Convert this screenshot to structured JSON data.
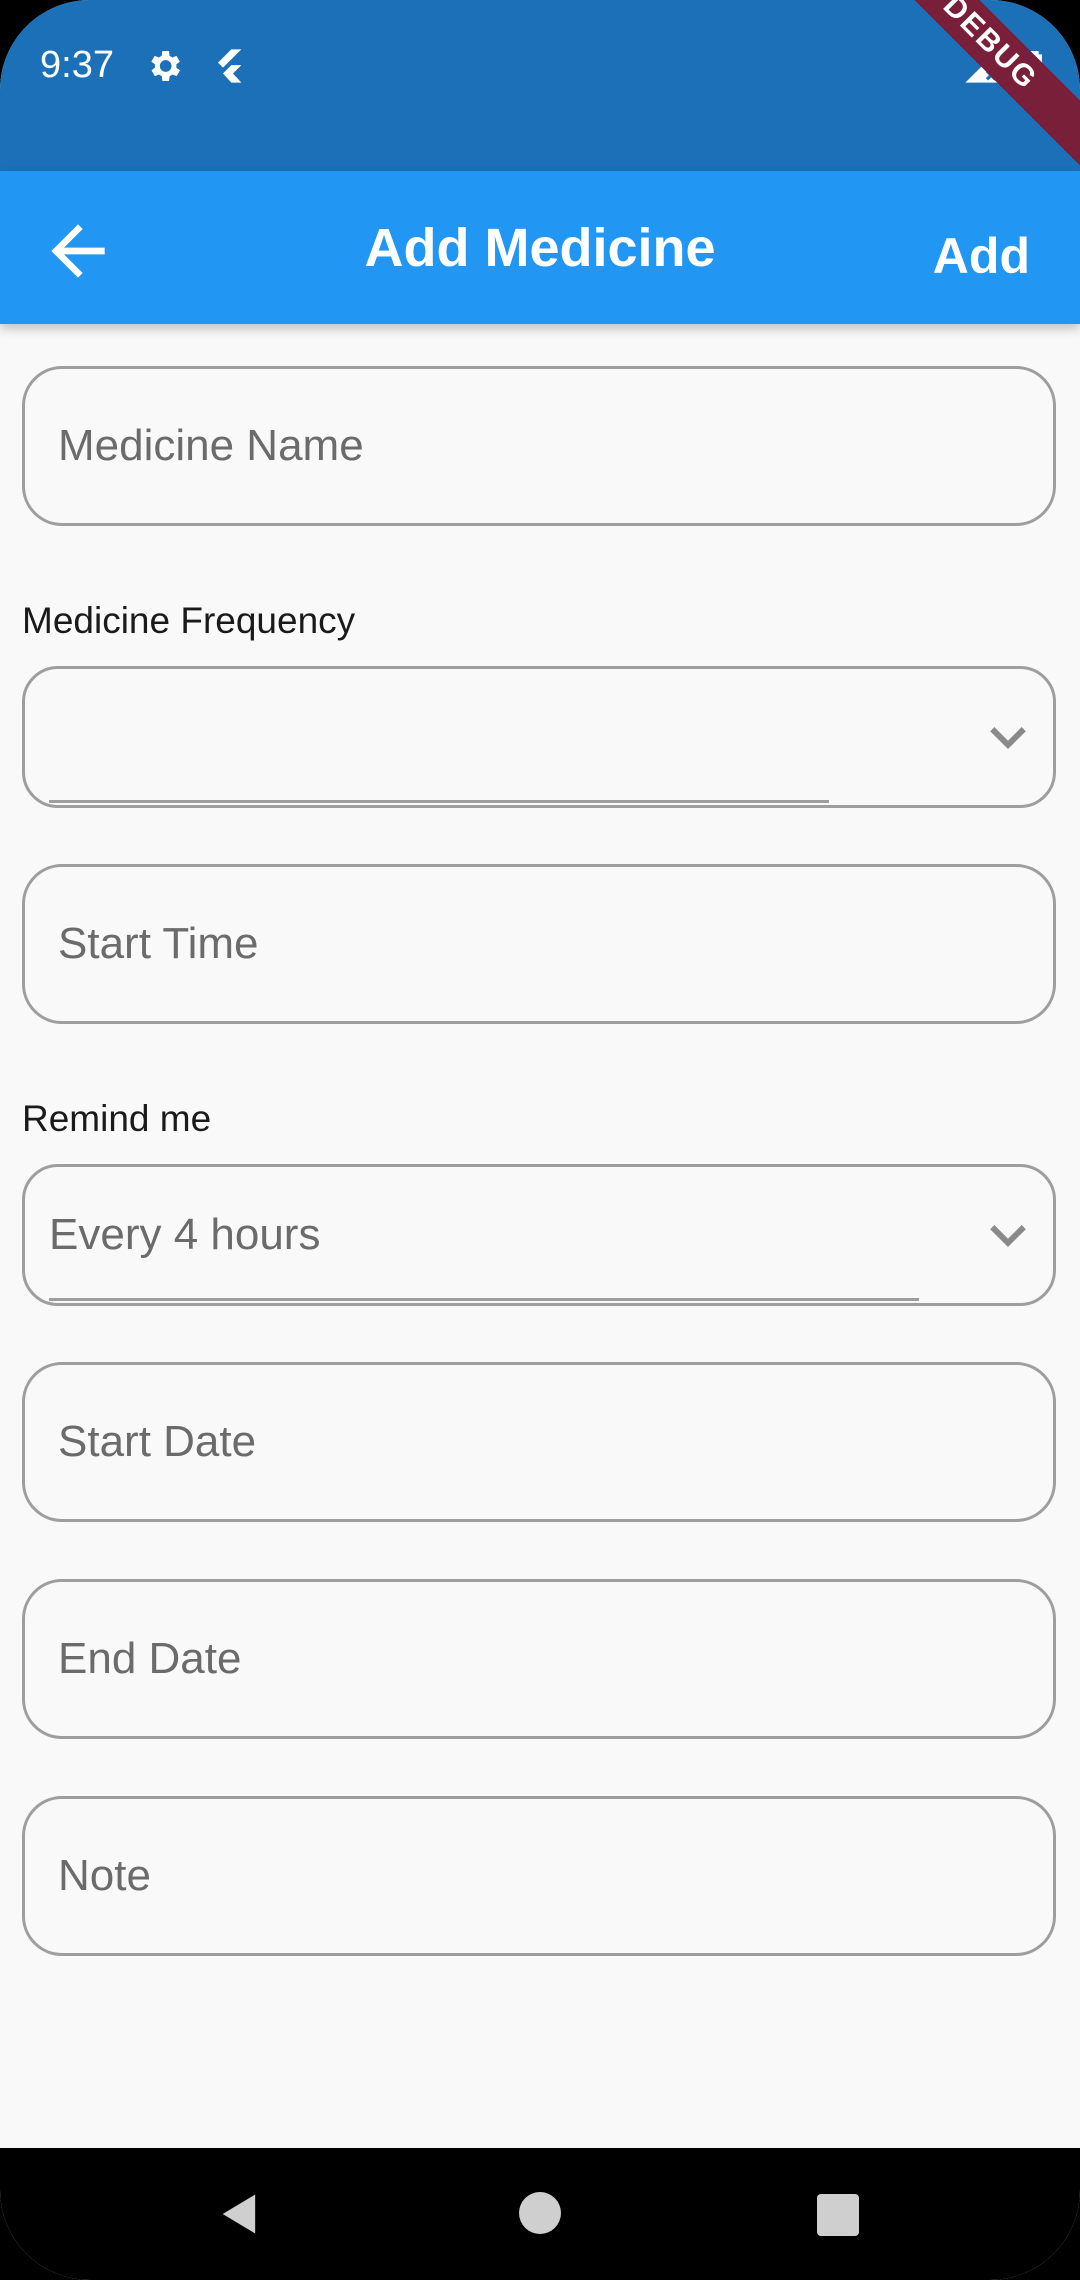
{
  "status_bar": {
    "time": "9:37",
    "icons": [
      "gear-icon",
      "flutter-icon",
      "signal-icon",
      "battery-icon"
    ],
    "debug_banner": "DEBUG",
    "color": "#1b70b8"
  },
  "app_bar": {
    "title": "Add Medicine",
    "action_label": "Add",
    "back_icon": "arrow-back-icon",
    "color": "#2196f3"
  },
  "form": {
    "medicine_name": {
      "placeholder": "Medicine Name",
      "value": ""
    },
    "frequency": {
      "label": "Medicine Frequency",
      "selected": ""
    },
    "start_time": {
      "placeholder": "Start Time",
      "value": ""
    },
    "remind": {
      "label": "Remind me",
      "selected": "Every 4 hours"
    },
    "start_date": {
      "placeholder": "Start Date",
      "value": ""
    },
    "end_date": {
      "placeholder": "End Date",
      "value": ""
    },
    "note": {
      "placeholder": "Note",
      "value": ""
    }
  },
  "nav_bar": {
    "icons": [
      "nav-back-icon",
      "nav-home-icon",
      "nav-recents-icon"
    ]
  }
}
